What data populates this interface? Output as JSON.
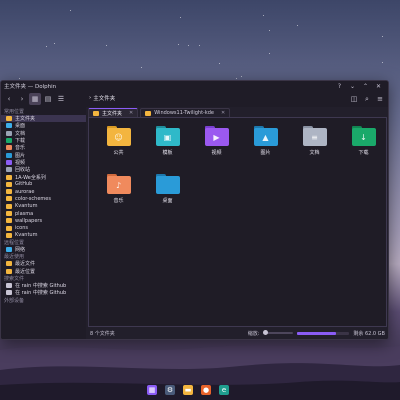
{
  "window": {
    "title": "主文件夹 — Dolphin"
  },
  "window_controls": {
    "help": "?",
    "minimize": "⌄",
    "maximize": "⌃",
    "close": "✕"
  },
  "pathbar": {
    "location": "主文件夹"
  },
  "tabs": [
    {
      "label": "主文件夹"
    },
    {
      "label": "Windows11-Twilight-kde"
    }
  ],
  "sidebar": {
    "places_header": "常用位置",
    "places": [
      {
        "label": "主文件夹",
        "icon": "home-icon",
        "color": "#f3b53f"
      },
      {
        "label": "桌面",
        "icon": "desktop-icon",
        "color": "#3daee9"
      },
      {
        "label": "文档",
        "icon": "documents-icon",
        "color": "#9aa3b5"
      },
      {
        "label": "下载",
        "icon": "downloads-icon",
        "color": "#1aa96a"
      },
      {
        "label": "音乐",
        "icon": "music-icon",
        "color": "#f08a5d"
      },
      {
        "label": "图片",
        "icon": "pictures-icon",
        "color": "#2a9bd8"
      },
      {
        "label": "视频",
        "icon": "videos-icon",
        "color": "#8b5cf6"
      },
      {
        "label": "回收站",
        "icon": "trash-icon",
        "color": "#9aa3b5"
      },
      {
        "label": "1A-We全系列",
        "icon": "folder-icon",
        "color": "#f3b53f"
      },
      {
        "label": "GitHub",
        "icon": "folder-icon",
        "color": "#f3b53f"
      },
      {
        "label": "aurorae",
        "icon": "folder-icon",
        "color": "#f3b53f"
      },
      {
        "label": "color-schemes",
        "icon": "folder-icon",
        "color": "#f3b53f"
      },
      {
        "label": "Kvantum",
        "icon": "folder-icon",
        "color": "#f3b53f"
      },
      {
        "label": "plasma",
        "icon": "folder-icon",
        "color": "#f3b53f"
      },
      {
        "label": "wallpapers",
        "icon": "folder-icon",
        "color": "#f3b53f"
      },
      {
        "label": "icons",
        "icon": "folder-icon",
        "color": "#f3b53f"
      },
      {
        "label": "Kvantum",
        "icon": "folder-icon",
        "color": "#f3b53f"
      }
    ],
    "remote_header": "远程位置",
    "remote": [
      {
        "label": "网络",
        "icon": "network-icon",
        "color": "#3daee9"
      }
    ],
    "recent_header": "最近使用",
    "recent": [
      {
        "label": "最近文件",
        "icon": "recent-files-icon",
        "color": "#f3b53f"
      },
      {
        "label": "最近位置",
        "icon": "recent-locations-icon",
        "color": "#f3b53f"
      }
    ],
    "search_header": "搜索文件",
    "search": [
      {
        "label": "在 rain 中搜索 Github",
        "icon": "search-icon",
        "color": "#c8c4d4"
      },
      {
        "label": "在 rain 中搜索 Github",
        "icon": "search-icon",
        "color": "#c8c4d4"
      }
    ],
    "devices_header": "外部设备"
  },
  "files": [
    {
      "label": "公共",
      "icon": "public-folder-icon",
      "color": "#f3b53f",
      "back": "#d99a24",
      "glyph": "☺"
    },
    {
      "label": "模板",
      "icon": "templates-folder-icon",
      "color": "#2fb9c9",
      "back": "#1f8e9c",
      "glyph": "▣"
    },
    {
      "label": "视频",
      "icon": "videos-folder-icon",
      "color": "#9b59f0",
      "back": "#7a3fd1",
      "glyph": "▶"
    },
    {
      "label": "图片",
      "icon": "pictures-folder-icon",
      "color": "#2a9bd8",
      "back": "#1c78ad",
      "glyph": "▲"
    },
    {
      "label": "文档",
      "icon": "documents-folder-icon",
      "color": "#aeb5c4",
      "back": "#8a92a3",
      "glyph": "≡"
    },
    {
      "label": "下载",
      "icon": "downloads-folder-icon",
      "color": "#1aa96a",
      "back": "#118552",
      "glyph": "↓"
    },
    {
      "label": "音乐",
      "icon": "music-folder-icon",
      "color": "#f08a5d",
      "back": "#d06a3d",
      "glyph": "♪"
    },
    {
      "label": "桌面",
      "icon": "desktop-folder-icon",
      "color": "#2a9bd8",
      "back": "#1c78ad",
      "glyph": ""
    }
  ],
  "status": {
    "count": "8 个文件夹",
    "zoom_label": "缩放:",
    "free_space": "剩余 62.0 GB",
    "used_fraction": 0.75
  },
  "taskbar": [
    {
      "name": "start-icon",
      "color": "#8b5cf6",
      "glyph": "▦"
    },
    {
      "name": "settings-icon",
      "color": "#4a5b7a",
      "glyph": "⚙"
    },
    {
      "name": "file-manager-icon",
      "color": "#f3b53f",
      "glyph": "▬"
    },
    {
      "name": "firefox-icon",
      "color": "#e8632b",
      "glyph": "●"
    },
    {
      "name": "edge-icon",
      "color": "#1f9e8f",
      "glyph": "e"
    }
  ]
}
